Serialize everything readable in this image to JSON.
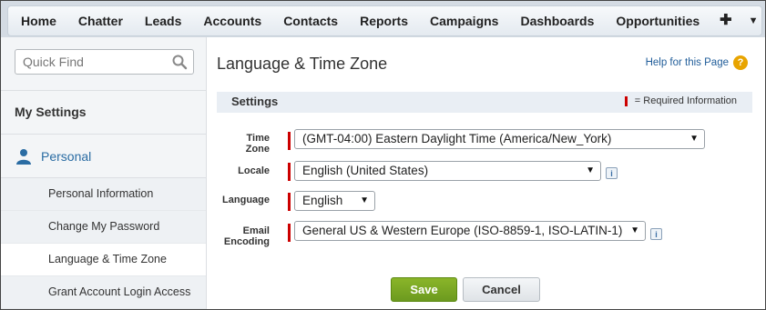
{
  "nav": {
    "tabs": [
      "Home",
      "Chatter",
      "Leads",
      "Accounts",
      "Contacts",
      "Reports",
      "Campaigns",
      "Dashboards",
      "Opportunities"
    ],
    "plus_icon": "plus-icon",
    "more_icon": "caret-down-icon"
  },
  "sidebar": {
    "quickfind_placeholder": "Quick Find",
    "my_settings": "My Settings",
    "section": "Personal",
    "items": [
      {
        "label": "Personal Information",
        "active": false
      },
      {
        "label": "Change My Password",
        "active": false
      },
      {
        "label": "Language & Time Zone",
        "active": true
      },
      {
        "label": "Grant Account Login Access",
        "active": false
      }
    ]
  },
  "main": {
    "title": "Language & Time Zone",
    "help_link": "Help for this Page",
    "settings_header": "Settings",
    "required_legend": "= Required Information",
    "fields": {
      "timezone_label_1": "Time",
      "timezone_label_2": "Zone",
      "timezone_value": "(GMT-04:00) Eastern Daylight Time (America/New_York)",
      "locale_label": "Locale",
      "locale_value": "English (United States)",
      "language_label": "Language",
      "language_value": "English",
      "encoding_label_1": "Email",
      "encoding_label_2": "Encoding",
      "encoding_value": "General US & Western Europe (ISO-8859-1, ISO-LATIN-1)"
    },
    "save_label": "Save",
    "cancel_label": "Cancel"
  },
  "colors": {
    "link": "#2a6ca3",
    "required": "#cc0000",
    "save_button": "#6c9a1f",
    "help_icon": "#e8a400"
  }
}
